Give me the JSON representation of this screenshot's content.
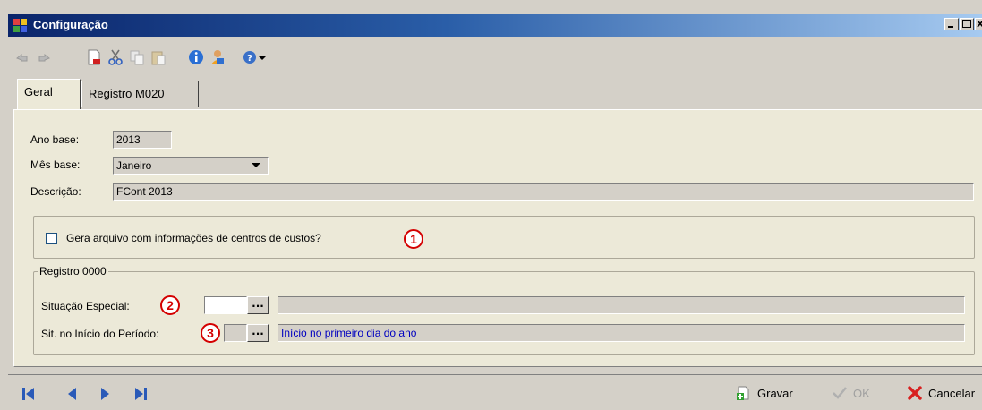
{
  "window": {
    "title": "Configuração",
    "controls": [
      "minimize",
      "maximize",
      "close"
    ]
  },
  "toolbar": {
    "icons": [
      "undo-icon",
      "redo-icon",
      "new-document-icon",
      "cut-icon",
      "copy-icon",
      "paste-icon",
      "info-icon",
      "user-icon",
      "help-icon",
      "dropdown-arrow-icon"
    ]
  },
  "tabs": [
    {
      "label": "Geral",
      "active": true
    },
    {
      "label": "Registro M020",
      "active": false
    }
  ],
  "form": {
    "ano_base_label": "Ano base:",
    "ano_base_value": "2013",
    "mes_base_label": "Mês base:",
    "mes_base_value": "Janeiro",
    "descricao_label": "Descrição:",
    "descricao_value": "FCont 2013",
    "centros_custos_label": "Gera arquivo com informações de centros de custos?",
    "centros_custos_checked": false
  },
  "registro_0000": {
    "legend": "Registro 0000",
    "situacao_especial_label": "Situação Especial:",
    "situacao_especial_code": "",
    "situacao_especial_desc": "",
    "sit_inicio_label": "Sit. no Início do Período:",
    "sit_inicio_code": "",
    "sit_inicio_desc": "Início no primeiro dia do ano",
    "ellipsis": "..."
  },
  "callouts": [
    "1",
    "2",
    "3"
  ],
  "bottom": {
    "gravar_label": "Gravar",
    "ok_label": "OK",
    "cancelar_label": "Cancelar"
  },
  "colors": {
    "title_gradient_start": "#0a246a",
    "callout_red": "#d40000",
    "link_blue": "#0000c0"
  }
}
